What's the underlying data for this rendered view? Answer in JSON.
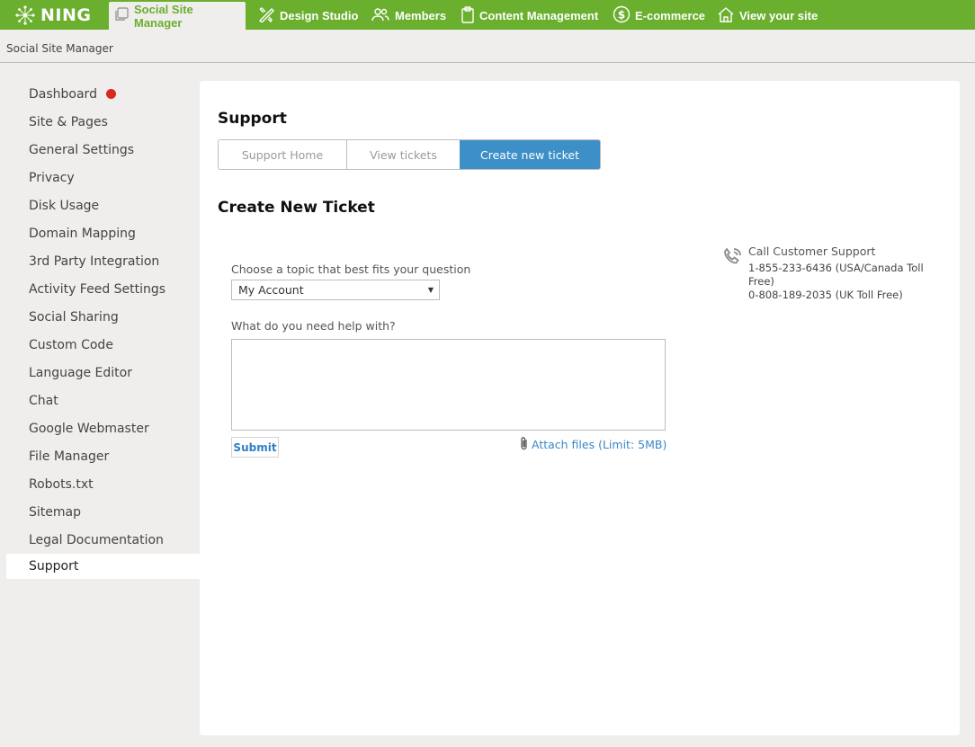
{
  "brand": {
    "name": "NING"
  },
  "nav": {
    "tabs": [
      {
        "label": "Social Site Manager",
        "icon": "copy-icon"
      },
      {
        "label": "Design Studio",
        "icon": "design-tools-icon"
      },
      {
        "label": "Members",
        "icon": "people-icon"
      },
      {
        "label": "Content Management",
        "icon": "clipboard-icon"
      },
      {
        "label": "E-commerce",
        "icon": "dollar-icon"
      },
      {
        "label": "View your site",
        "icon": "home-icon"
      }
    ]
  },
  "breadcrumb": "Social Site Manager",
  "sidebar": {
    "items": [
      {
        "label": "Dashboard"
      },
      {
        "label": "Site & Pages"
      },
      {
        "label": "General Settings"
      },
      {
        "label": "Privacy"
      },
      {
        "label": "Disk Usage"
      },
      {
        "label": "Domain Mapping"
      },
      {
        "label": "3rd Party Integration"
      },
      {
        "label": "Activity Feed Settings"
      },
      {
        "label": "Social Sharing"
      },
      {
        "label": "Custom Code"
      },
      {
        "label": "Language Editor"
      },
      {
        "label": "Chat"
      },
      {
        "label": "Google Webmaster"
      },
      {
        "label": "File Manager"
      },
      {
        "label": "Robots.txt"
      },
      {
        "label": "Sitemap"
      },
      {
        "label": "Legal Documentation"
      },
      {
        "label": "Support"
      }
    ]
  },
  "main": {
    "title": "Support",
    "tabs": [
      {
        "label": "Support Home"
      },
      {
        "label": "View tickets"
      },
      {
        "label": "Create new ticket"
      }
    ],
    "section_title": "Create New Ticket",
    "topic_label": "Choose a topic that best fits your question",
    "topic_value": "My Account",
    "help_label": "What do you need help with?",
    "help_value": "",
    "submit_label": "Submit",
    "attach_label": "Attach files (Limit: 5MB)"
  },
  "support": {
    "title": "Call Customer Support",
    "phone_us": "1-855-233-6436 (USA/Canada Toll Free)",
    "phone_uk": "0-808-189-2035 (UK Toll Free)"
  },
  "colors": {
    "nav_green": "#6aaf2e",
    "active_tab_blue": "#3d8fc7",
    "link_blue": "#3a87c8",
    "notification_red": "#d8281f"
  }
}
